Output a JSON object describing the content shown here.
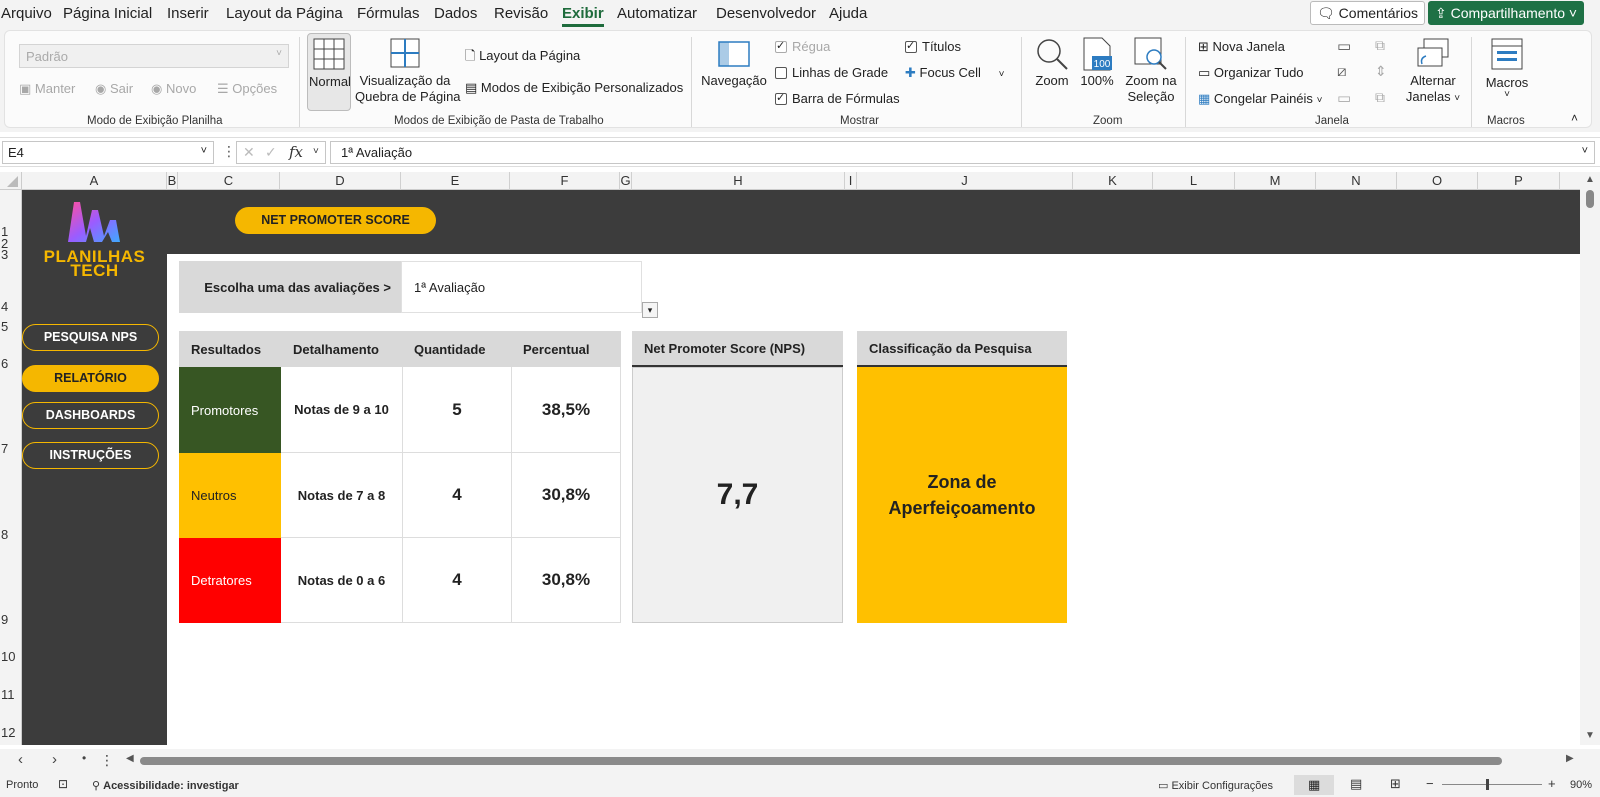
{
  "menu": {
    "items": [
      "Arquivo",
      "Página Inicial",
      "Inserir",
      "Layout da Página",
      "Fórmulas",
      "Dados",
      "Revisão",
      "Exibir",
      "Automatizar",
      "Desenvolvedor",
      "Ajuda"
    ],
    "active": "Exibir",
    "comments_label": "Comentários",
    "share_label": "Compartilhamento"
  },
  "ribbon": {
    "sheet_view": {
      "dropdown_value": "Padrão",
      "keep": "Manter",
      "exit": "Sair",
      "new": "Novo",
      "options": "Opções",
      "group_label": "Modo de Exibição Planilha"
    },
    "workbook_views": {
      "normal": "Normal",
      "page_break_line1": "Visualização da",
      "page_break_line2": "Quebra de Página",
      "page_layout": "Layout da Página",
      "custom_views": "Modos de Exibição Personalizados",
      "group_label": "Modos de Exibição de Pasta de Trabalho"
    },
    "show": {
      "navigation": "Navegação",
      "ruler": "Régua",
      "gridlines": "Linhas de Grade",
      "formula_bar": "Barra de Fórmulas",
      "headings": "Títulos",
      "focus_cell": "Focus Cell",
      "group_label": "Mostrar"
    },
    "zoom": {
      "zoom": "Zoom",
      "hundred": "100%",
      "zoom_sel_line1": "Zoom na",
      "zoom_sel_line2": "Seleção",
      "icon_number": "100",
      "group_label": "Zoom"
    },
    "window": {
      "new_window": "Nova Janela",
      "arrange_all": "Organizar Tudo",
      "freeze_panes": "Congelar Painéis",
      "switch_line1": "Alternar",
      "switch_line2": "Janelas",
      "group_label": "Janela"
    },
    "macros": {
      "label": "Macros",
      "group_label": "Macros"
    }
  },
  "formula_bar": {
    "name_box": "E4",
    "formula": "1ª Avaliação"
  },
  "columns": [
    "A",
    "B",
    "C",
    "D",
    "E",
    "F",
    "G",
    "H",
    "I",
    "J",
    "K",
    "L",
    "M",
    "N",
    "O",
    "P"
  ],
  "rows": [
    "1",
    "2",
    "3",
    "4",
    "5",
    "6",
    "7",
    "8",
    "9",
    "10",
    "11",
    "12"
  ],
  "sheet": {
    "logo_line1": "PLANILHAS",
    "logo_line2": "TECH",
    "title_pill": "NET PROMOTER SCORE",
    "nav": [
      {
        "label": "PESQUISA NPS",
        "active": false
      },
      {
        "label": "RELATÓRIO",
        "active": true
      },
      {
        "label": "DASHBOARDS",
        "active": false
      },
      {
        "label": "INSTRUÇÕES",
        "active": false
      }
    ],
    "selector_label": "Escolha uma das avaliações >",
    "selector_value": "1ª Avaliação",
    "table_headers": [
      "Resultados",
      "Detalhamento",
      "Quantidade",
      "Percentual"
    ],
    "table_rows": [
      {
        "result": "Promotores",
        "detail": "Notas de 9 a 10",
        "qty": "5",
        "pct": "38,5%",
        "color": "#375623"
      },
      {
        "result": "Neutros",
        "detail": "Notas de 7 a 8",
        "qty": "4",
        "pct": "30,8%",
        "color": "#ffc000"
      },
      {
        "result": "Detratores",
        "detail": "Notas de 0 a 6",
        "qty": "4",
        "pct": "30,8%",
        "color": "#ff0000"
      }
    ],
    "nps_header": "Net Promoter Score (NPS)",
    "nps_value": "7,7",
    "class_header": "Classificação da Pesquisa",
    "class_value_line1": "Zona de",
    "class_value_line2": "Aperfeiçoamento",
    "accent": "#f5b700"
  },
  "status": {
    "ready": "Pronto",
    "accessibility": "Acessibilidade: investigar",
    "display_settings": "Exibir Configurações",
    "zoom": "90%"
  }
}
